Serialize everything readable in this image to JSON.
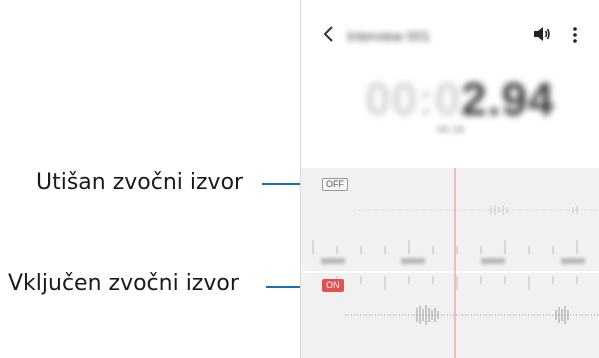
{
  "callouts": {
    "muted": "Utišan zvočni izvor",
    "active": "Vključen zvočni izvor"
  },
  "app_bar": {
    "title": "Interview 001",
    "back_icon": "chevron-left-icon",
    "speaker_icon": "speaker-icon",
    "more_icon": "more-vertical-icon"
  },
  "timer": {
    "dim": "00:0",
    "bright": "2.94",
    "subtitle": "00:16"
  },
  "tracks": {
    "top_badge": "OFF",
    "bottom_badge": "ON"
  },
  "colors": {
    "leader_line": "#1b6fae",
    "playhead": "#e88a8a",
    "on_badge": "#e2514f"
  }
}
